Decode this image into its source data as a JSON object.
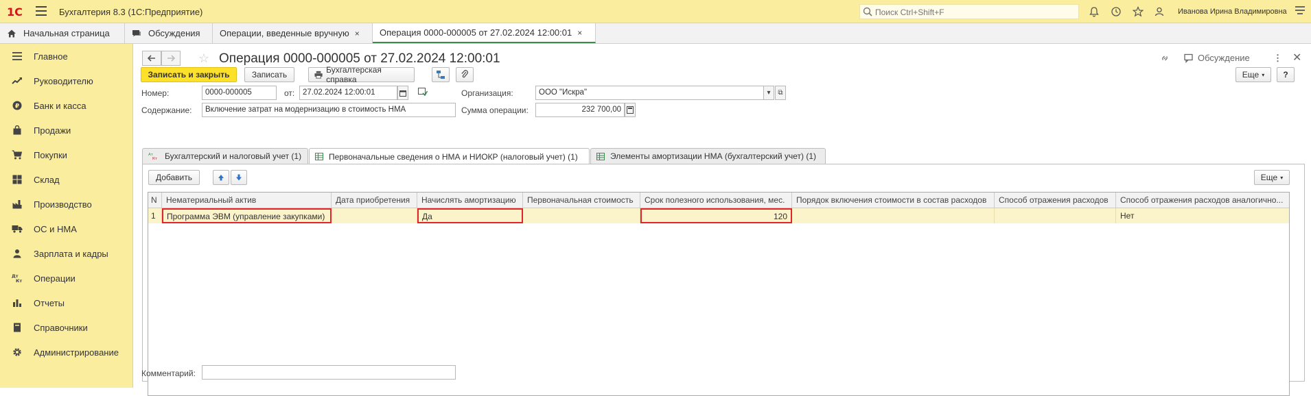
{
  "app": {
    "logo": "1С",
    "title": "Бухгалтерия 8.3  (1С:Предприятие)",
    "search_placeholder": "Поиск Ctrl+Shift+F",
    "user": "Иванова Ирина Владимировна",
    "top_icons": [
      "bell-icon",
      "history-icon",
      "star-icon",
      "users-icon"
    ]
  },
  "tabs": [
    {
      "label": "Начальная страница",
      "icon": "home-icon"
    },
    {
      "label": "Обсуждения",
      "icon": "chat-icon"
    },
    {
      "label": "Операции, введенные вручную",
      "close": "×"
    },
    {
      "label": "Операция 0000-000005 от 27.02.2024 12:00:01",
      "close": "×",
      "active": true
    }
  ],
  "sidebar": {
    "items": [
      {
        "label": "Главное",
        "icon": "menu-icon"
      },
      {
        "label": "Руководителю",
        "icon": "chart-line-icon"
      },
      {
        "label": "Банк и касса",
        "icon": "ruble-icon"
      },
      {
        "label": "Продажи",
        "icon": "bag-icon"
      },
      {
        "label": "Покупки",
        "icon": "cart-icon"
      },
      {
        "label": "Склад",
        "icon": "warehouse-icon"
      },
      {
        "label": "Производство",
        "icon": "factory-icon"
      },
      {
        "label": "ОС и НМА",
        "icon": "truck-icon"
      },
      {
        "label": "Зарплата и кадры",
        "icon": "person-icon"
      },
      {
        "label": "Операции",
        "icon": "dt-kt-icon"
      },
      {
        "label": "Отчеты",
        "icon": "bar-chart-icon"
      },
      {
        "label": "Справочники",
        "icon": "book-icon"
      },
      {
        "label": "Администрирование",
        "icon": "gear-icon"
      }
    ]
  },
  "document": {
    "title": "Операция 0000-000005 от 27.02.2024 12:00:01",
    "discussion_label": "Обсуждение",
    "toolbar": {
      "save_close": "Записать и закрыть",
      "save": "Записать",
      "print": "Бухгалтерская справка",
      "more": "Еще",
      "help": "?"
    },
    "fields": {
      "number_label": "Номер:",
      "number_value": "0000-000005",
      "date_label": "от:",
      "date_value": "27.02.2024 12:00:01",
      "org_label": "Организация:",
      "org_value": "ООО \"Искра\"",
      "content_label": "Содержание:",
      "content_value": "Включение затрат на модернизацию в стоимость НМА",
      "sum_label": "Сумма операции:",
      "sum_value": "232 700,00",
      "comment_label": "Комментарий:",
      "comment_value": ""
    },
    "form_tabs": [
      {
        "label": "Бухгалтерский и налоговый учет (1)",
        "icon": "dt-kt-icon"
      },
      {
        "label": "Первоначальные сведения о НМА и НИОКР (налоговый учет) (1)",
        "icon": "table-icon",
        "active": true
      },
      {
        "label": "Элементы амортизации НМА (бухгалтерский учет) (1)",
        "icon": "table-icon"
      }
    ],
    "table_toolbar": {
      "add": "Добавить",
      "more": "Еще"
    },
    "table": {
      "columns": [
        "N",
        "Нематериальный актив",
        "Дата приобретения",
        "Начислять амортизацию",
        "Первоначальная стоимость",
        "Срок полезного использования, мес.",
        "Порядок включения стоимости в состав расходов",
        "Способ отражения расходов",
        "Способ отражения расходов аналогично..."
      ],
      "rows": [
        [
          "1",
          "Программа ЭВМ (управление закупками)",
          "",
          "Да",
          "",
          "120",
          "",
          "",
          "Нет"
        ]
      ]
    }
  },
  "colors": {
    "sidebar_bg": "#fbed9e",
    "primary_button": "#fce02a",
    "highlight_border": "#e2242b",
    "selected_row": "#fbf3c9",
    "active_tab_underline": "#3a8d4c"
  }
}
